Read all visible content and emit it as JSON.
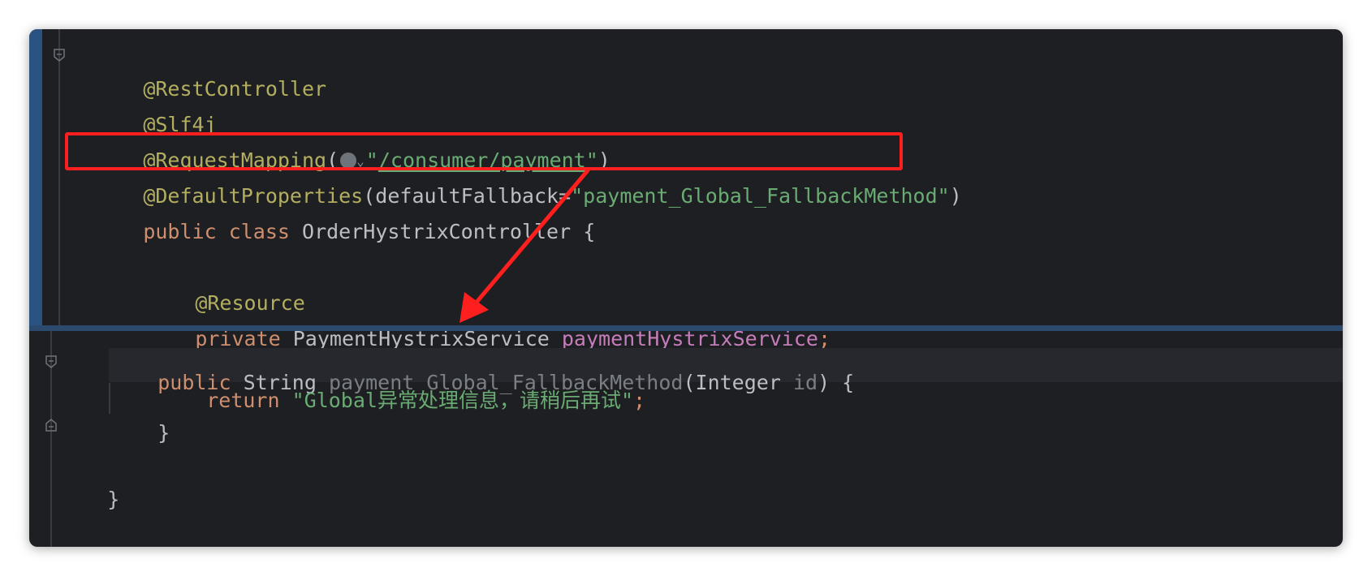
{
  "top_editor": {
    "lines": [
      {
        "annotation": "@RestController"
      },
      {
        "annotation": "@Slf4j"
      },
      {
        "annotation": "@RequestMapping",
        "paren_open": "(",
        "quote_open": "\"",
        "url": "/consumer/payment",
        "quote_close": "\"",
        "paren_close": ")"
      },
      {
        "annotation": "@DefaultProperties",
        "args": "(defaultFallback=",
        "string": "\"payment_Global_FallbackMethod\"",
        "paren_close": ")"
      },
      {
        "kw1": "public",
        "kw2": "class",
        "name": "OrderHystrixController {"
      },
      {
        "annotation": "@Resource"
      },
      {
        "kw": "private",
        "type": "PaymentHystrixService",
        "field": "paymentHystrixService",
        "semicolon": ";"
      }
    ]
  },
  "bottom_editor": {
    "method_line": {
      "kw": "public",
      "type": "String",
      "method": "payment_Global_FallbackMethod",
      "paren_open": "(",
      "param_type": "Integer",
      "param": "id",
      "rest": ") {"
    },
    "return_line": {
      "kw": "return",
      "string": "\"Global异常处理信息，请稍后再试\"",
      "semicolon": ";"
    },
    "close_method": "}",
    "close_class": "}"
  },
  "icons": {
    "globe": "globe-icon",
    "chevron": "chevron-down-icon",
    "fold": "fold-icon"
  },
  "colors": {
    "background": "#1e1f22",
    "annotation": "#b3ae60",
    "keyword": "#cf8e6d",
    "string": "#6aab73",
    "field": "#c77dbb",
    "highlight_red": "#ff1f1f",
    "split_blue": "#2a5382"
  }
}
